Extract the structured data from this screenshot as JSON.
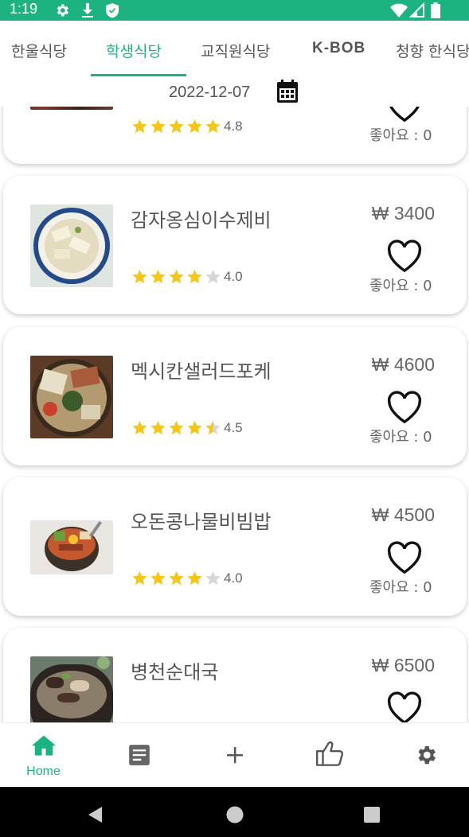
{
  "status_bar": {
    "time": "1:19",
    "icons": [
      "gear-icon",
      "download-icon",
      "shield-icon",
      "wifi-icon",
      "signal-icon",
      "battery-icon"
    ],
    "background": "#1db380"
  },
  "tabs": [
    {
      "label": "한울식당",
      "active": false
    },
    {
      "label": "학생식당",
      "active": true
    },
    {
      "label": "교직원식당",
      "active": false
    },
    {
      "label": "K-BOB",
      "active": false
    },
    {
      "label": "청향 한식당",
      "active": false
    }
  ],
  "date": {
    "value": "2022-12-07",
    "icon": "calendar-icon"
  },
  "menu_items": [
    {
      "name": "",
      "price": "",
      "rating": 4.8,
      "rating_label": "4.8",
      "likes_label": "좋아요 : 0",
      "image": "food-photo-partial"
    },
    {
      "name": "감자옹심이수제비",
      "price": "₩ 3400",
      "rating": 4.0,
      "rating_label": "4.0",
      "likes_label": "좋아요 : 0",
      "image": "soup-photo"
    },
    {
      "name": "멕시칸샐러드포케",
      "price": "₩ 4600",
      "rating": 4.5,
      "rating_label": "4.5",
      "likes_label": "좋아요 : 0",
      "image": "salad-bowl-photo"
    },
    {
      "name": "오돈콩나물비빔밥",
      "price": "₩ 4500",
      "rating": 4.0,
      "rating_label": "4.0",
      "likes_label": "좋아요 : 0",
      "image": "bibimbap-photo"
    },
    {
      "name": "병천순대국",
      "price": "₩ 6500",
      "rating": null,
      "rating_label": "",
      "likes_label": "",
      "image": "sundae-soup-photo"
    }
  ],
  "bottom_nav": [
    {
      "icon": "home-icon",
      "label": "Home",
      "active": true
    },
    {
      "icon": "article-icon",
      "label": "",
      "active": false
    },
    {
      "icon": "plus-icon",
      "label": "",
      "active": false
    },
    {
      "icon": "thumbs-up-icon",
      "label": "",
      "active": false
    },
    {
      "icon": "settings-icon",
      "label": "",
      "active": false
    }
  ],
  "colors": {
    "accent": "#1db380",
    "star": "#f5c518",
    "star_empty": "#d6d6d6"
  }
}
